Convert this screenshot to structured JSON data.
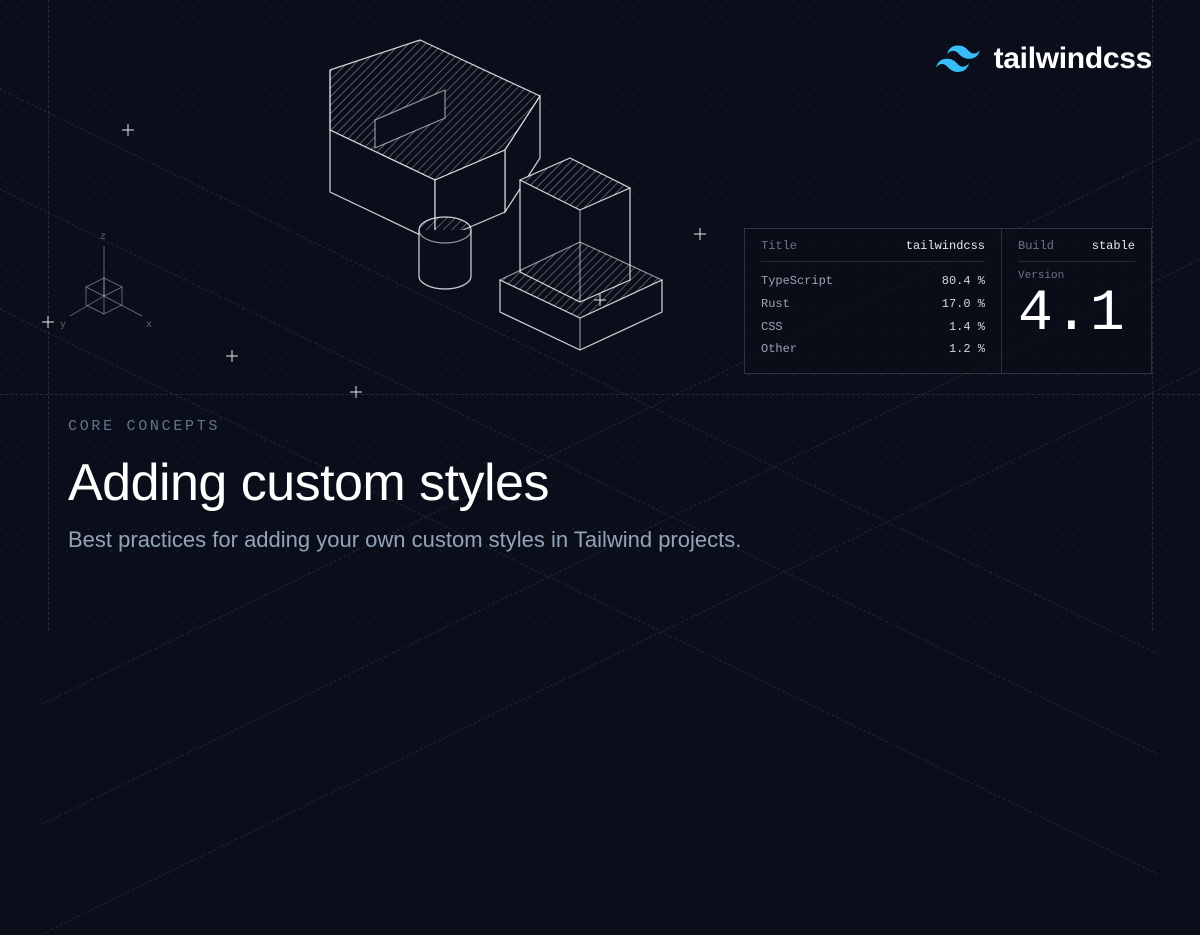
{
  "logo": {
    "text": "tailwindcss"
  },
  "axes": {
    "z": "z",
    "y": "y",
    "x": "x"
  },
  "panel": {
    "title_label": "Title",
    "title_value": "tailwindcss",
    "build_label": "Build",
    "build_value": "stable",
    "version_label": "Version",
    "version_value": "4.1",
    "languages": [
      {
        "name": "TypeScript",
        "pct": "80.4 %"
      },
      {
        "name": "Rust",
        "pct": "17.0 %"
      },
      {
        "name": "CSS",
        "pct": "1.4 %"
      },
      {
        "name": "Other",
        "pct": "1.2 %"
      }
    ]
  },
  "content": {
    "eyebrow": "CORE CONCEPTS",
    "title": "Adding custom styles",
    "subtitle": "Best practices for adding your own custom styles in Tailwind projects."
  }
}
